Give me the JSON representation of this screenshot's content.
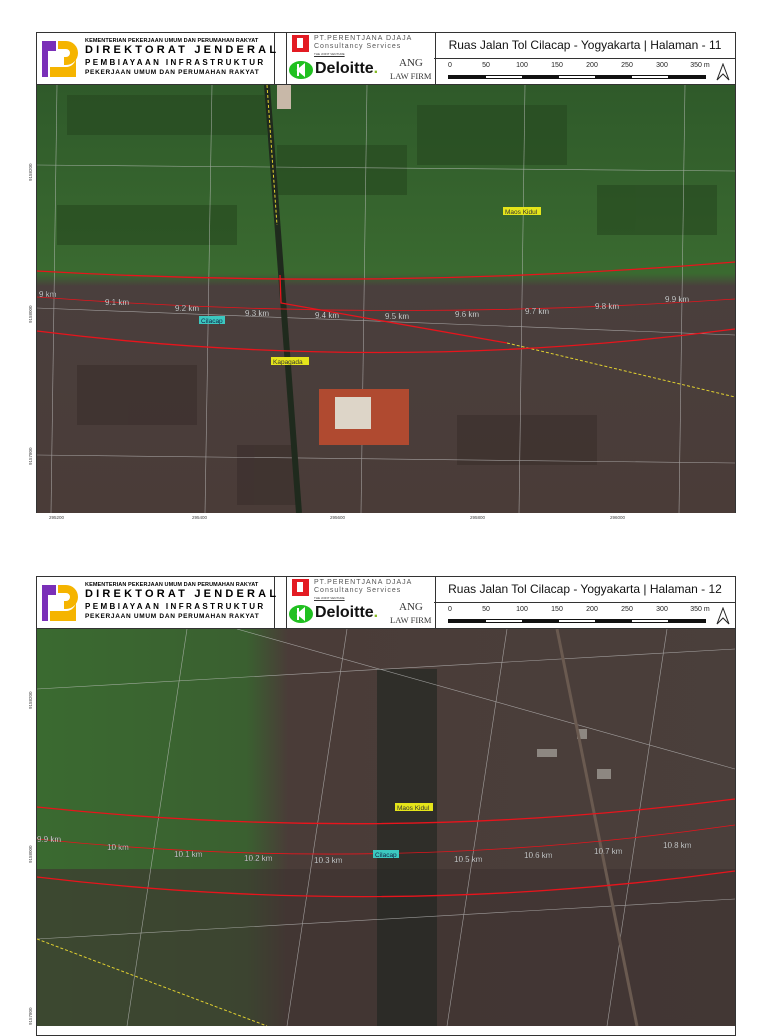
{
  "header": {
    "ministry": "KEMENTERIAN PEKERJAAN UMUM DAN PERUMAHAN RAKYAT",
    "directorate": "DIREKTORAT JENDERAL",
    "division": "PEMBIAYAAN INFRASTRUKTUR",
    "division_sub": "PEKERJAAN UMUM DAN PERUMAHAN RAKYAT",
    "consultant_line1": "PT.PERENTJANA DJAJA",
    "consultant_line2": "Consultancy Services",
    "joint_venture": "THE JOINT VENTURE",
    "deloitte": "Deloitte",
    "deloitte_dot": ".",
    "ang": "ANG",
    "law_firm": "LAW FIRM",
    "scale_ticks": [
      "0",
      "50",
      "100",
      "150",
      "200",
      "250",
      "300",
      "350 m"
    ]
  },
  "pages": [
    {
      "title": "Ruas Jalan Tol Cilacap - Yogyakarta | Halaman - 11",
      "km_labels": [
        "9 km",
        "9.1 km",
        "9.2 km",
        "9.3 km",
        "9.4 km",
        "9.5 km",
        "9.6 km",
        "9.7 km",
        "9.8 km",
        "9.9 km"
      ],
      "places": {
        "maos_kidul": "Maos Kidul",
        "cilacap": "Cilacap",
        "kapagada": "Kapagada"
      },
      "x_coords": [
        "295200",
        "295400",
        "295600",
        "295800",
        "296000"
      ],
      "y_coords": [
        "9158200",
        "9158000",
        "9157800"
      ]
    },
    {
      "title": "Ruas Jalan Tol Cilacap - Yogyakarta | Halaman - 12",
      "km_labels": [
        "9.9 km",
        "10 km",
        "10.1 km",
        "10.2 km",
        "10.3 km",
        "10.5 km",
        "10.6 km",
        "10.7 km",
        "10.8 km"
      ],
      "places": {
        "maos_kidul": "Maos Kidul",
        "cilacap": "Cilacap"
      },
      "y_coords": [
        "9158200",
        "9158000",
        "9157800"
      ]
    }
  ],
  "colors": {
    "alignment": "#e8141c",
    "place_label": "#e5e51a",
    "river_label": "#3cc8c0"
  }
}
